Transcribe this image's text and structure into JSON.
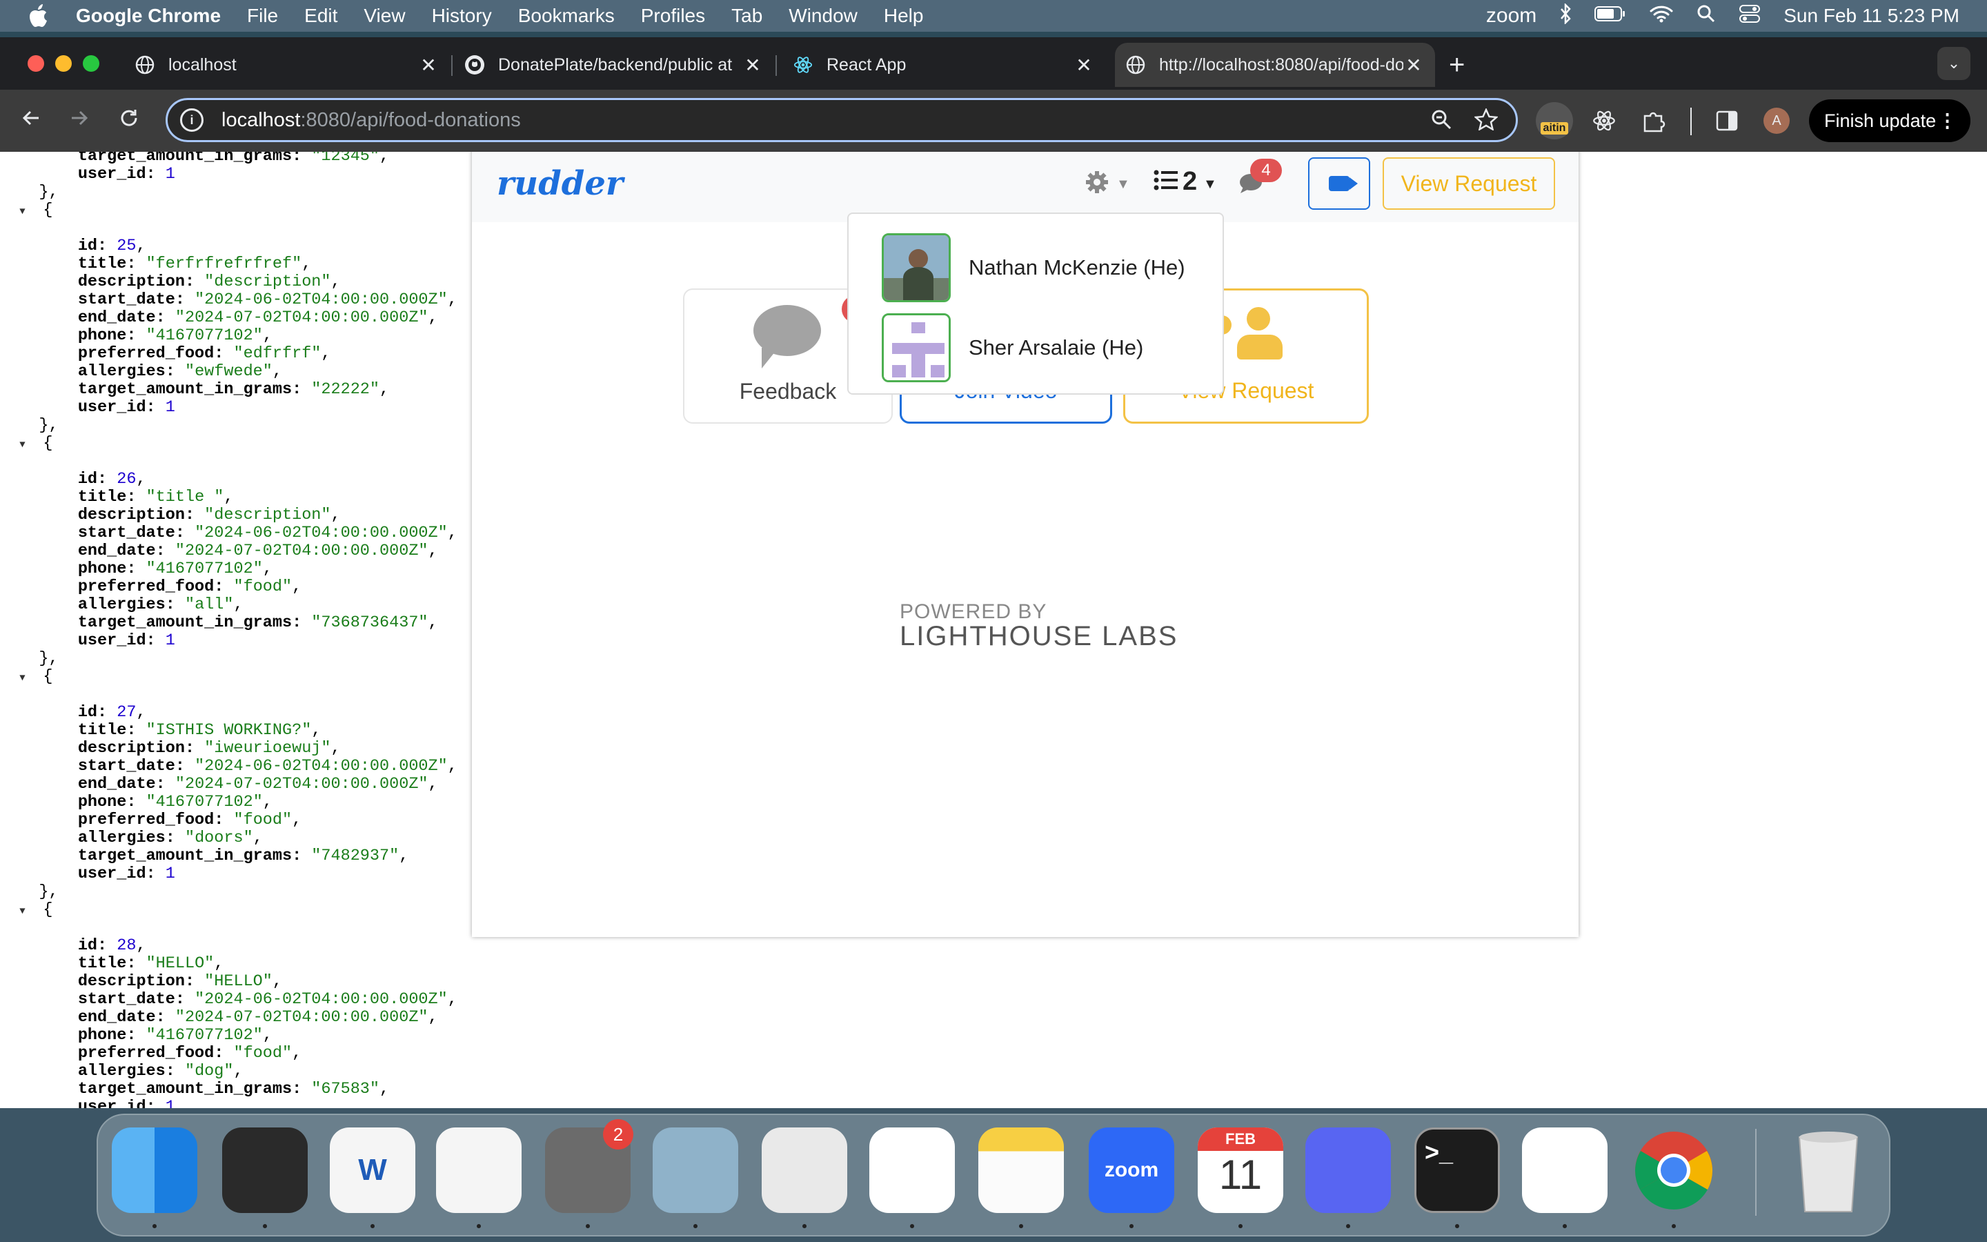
{
  "menubar": {
    "app_name": "Google Chrome",
    "items": [
      "File",
      "Edit",
      "View",
      "History",
      "Bookmarks",
      "Profiles",
      "Tab",
      "Window",
      "Help"
    ],
    "status": {
      "zoom_label": "zoom",
      "datetime": "Sun Feb 11  5:23 PM"
    }
  },
  "tabs": [
    {
      "title": "localhost"
    },
    {
      "title": "DonatePlate/backend/public at"
    },
    {
      "title": "React App"
    },
    {
      "title": "http://localhost:8080/api/food-donations"
    }
  ],
  "address_bar": {
    "host": "localhost",
    "path": ":8080/api/food-donations"
  },
  "extension_badge": "aitin",
  "profile_initial": "A",
  "finish_update_label": "Finish update",
  "json_view": {
    "head": [
      {
        "key": "target_amount_in_grams",
        "value": "\"12345\"",
        "type": "s",
        "comma": true
      },
      {
        "key": "user_id",
        "value": "1",
        "type": "n",
        "comma": false
      }
    ],
    "records": [
      {
        "id": "25",
        "title": "\"ferfrfrefrfref\"",
        "description": "\"description\"",
        "start_date": "\"2024-06-02T04:00:00.000Z\"",
        "end_date": "\"2024-07-02T04:00:00.000Z\"",
        "phone": "\"4167077102\"",
        "preferred_food": "\"edfrfrf\"",
        "allergies": "\"ewfwede\"",
        "target_amount_in_grams": "\"22222\"",
        "user_id": "1"
      },
      {
        "id": "26",
        "title": "\"title \"",
        "description": "\"description\"",
        "start_date": "\"2024-06-02T04:00:00.000Z\"",
        "end_date": "\"2024-07-02T04:00:00.000Z\"",
        "phone": "\"4167077102\"",
        "preferred_food": "\"food\"",
        "allergies": "\"all\"",
        "target_amount_in_grams": "\"7368736437\"",
        "user_id": "1"
      },
      {
        "id": "27",
        "title": "\"ISTHIS WORKING?\"",
        "description": "\"iweurioewuj\"",
        "start_date": "\"2024-06-02T04:00:00.000Z\"",
        "end_date": "\"2024-07-02T04:00:00.000Z\"",
        "phone": "\"4167077102\"",
        "preferred_food": "\"food\"",
        "allergies": "\"doors\"",
        "target_amount_in_grams": "\"7482937\"",
        "user_id": "1"
      },
      {
        "id": "28",
        "title": "\"HELLO\"",
        "description": "\"HELLO\"",
        "start_date": "\"2024-06-02T04:00:00.000Z\"",
        "end_date": "\"2024-07-02T04:00:00.000Z\"",
        "phone": "\"4167077102\"",
        "preferred_food": "\"food\"",
        "allergies": "\"dog\"",
        "target_amount_in_grams": "\"67583\"",
        "user_id": "1"
      }
    ]
  },
  "rudder": {
    "logo": "rudder",
    "participants_count": "2",
    "messages_badge": "4",
    "view_request_label": "View Request",
    "cards": [
      {
        "label": "Feedback"
      },
      {
        "label": "Join Video"
      },
      {
        "label": "View Request"
      }
    ],
    "participants": [
      {
        "name": "Nathan McKenzie (He)"
      },
      {
        "name": "Sher Arsalaie (He)"
      }
    ],
    "powered_by": "POWERED BY",
    "powered_brand": "LIGHTHOUSE LABS",
    "colors": {
      "primary": "#1d6fdc",
      "warning": "#f3c246",
      "badge": "#e05353",
      "avatar_border": "#4caf50"
    }
  },
  "dock": {
    "apps": [
      {
        "name": "Finder",
        "icon": "finder-icon"
      },
      {
        "name": "QuickTime Player",
        "icon": "quicktime-icon"
      },
      {
        "name": "Microsoft Word",
        "icon": "word-icon",
        "glyph": "W"
      },
      {
        "name": "Safari",
        "icon": "safari-icon"
      },
      {
        "name": "System Settings",
        "icon": "settings-icon"
      },
      {
        "name": "Preview",
        "icon": "preview-icon"
      },
      {
        "name": "Launchpad",
        "icon": "launchpad-icon"
      },
      {
        "name": "Freeform",
        "icon": "freeform-icon"
      },
      {
        "name": "Notes",
        "icon": "notes-icon"
      },
      {
        "name": "Zoom",
        "icon": "zoom-icon",
        "glyph": "zoom"
      },
      {
        "name": "Calendar",
        "icon": "calendar-icon",
        "month": "FEB",
        "day": "11"
      },
      {
        "name": "Discord",
        "icon": "discord-icon"
      },
      {
        "name": "Terminal",
        "icon": "terminal-icon",
        "glyph": ">_"
      },
      {
        "name": "Visual Studio Code",
        "icon": "vscode-icon"
      },
      {
        "name": "Google Chrome",
        "icon": "chrome-icon"
      },
      {
        "name": "Trash",
        "icon": "trash-icon"
      }
    ],
    "settings_badge": "2"
  }
}
